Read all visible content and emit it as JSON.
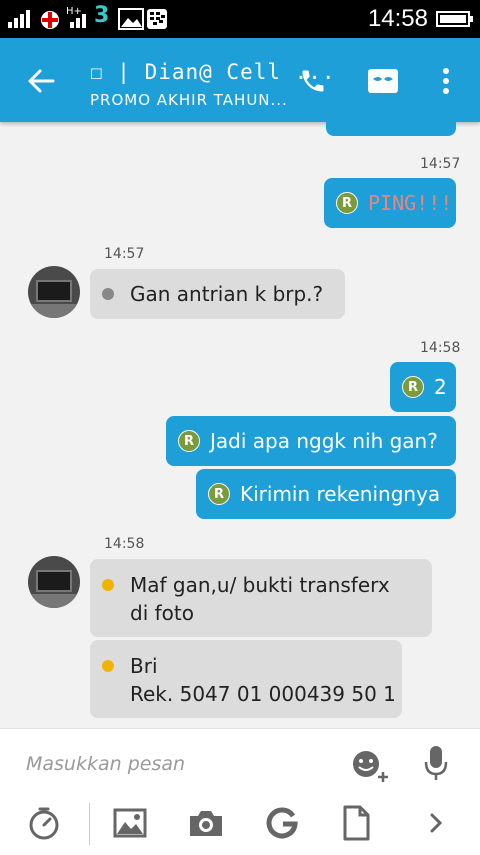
{
  "status": {
    "time": "14:58",
    "network": "H+",
    "carrier_badge": "3"
  },
  "header": {
    "title": "☐ | Dian@ Cell ...",
    "subtitle": "PROMO AKHIR TAHUN..."
  },
  "messages": [
    {
      "dir": "out",
      "time": "14:57",
      "badge": "R",
      "text": "PING!!!",
      "color": "#f08080"
    },
    {
      "dir": "in",
      "time": "14:57",
      "text": "Gan antrian k brp.?",
      "dot_color": "#888888"
    },
    {
      "dir": "out",
      "time": "14:58",
      "badge": "R",
      "text": "2"
    },
    {
      "dir": "out",
      "badge": "R",
      "text": "Jadi apa nggk nih gan?"
    },
    {
      "dir": "out",
      "badge": "R",
      "text": "Kirimin rekeningnya"
    },
    {
      "dir": "in",
      "time": "14:58",
      "text_line1": "Maf gan,u/ bukti transferx",
      "text_line2": "di foto",
      "dot_color": "#f0b400"
    },
    {
      "dir": "in",
      "text_line1": "Bri",
      "text_line2": "Rek. 5047 01 000439 50 1",
      "dot_color": "#f0b400"
    }
  ],
  "composer": {
    "placeholder": "Masukkan pesan"
  },
  "colors": {
    "accent": "#1f9fd8",
    "incoming": "#dcdcdc",
    "badge": "#7a9a3c"
  },
  "icons": [
    "back-arrow-icon",
    "phone-icon",
    "mask-icon",
    "overflow-menu-icon",
    "emoji-add-icon",
    "microphone-icon",
    "timer-icon",
    "image-icon",
    "camera-icon",
    "refresh-g-icon",
    "file-icon",
    "chevron-right-icon"
  ]
}
